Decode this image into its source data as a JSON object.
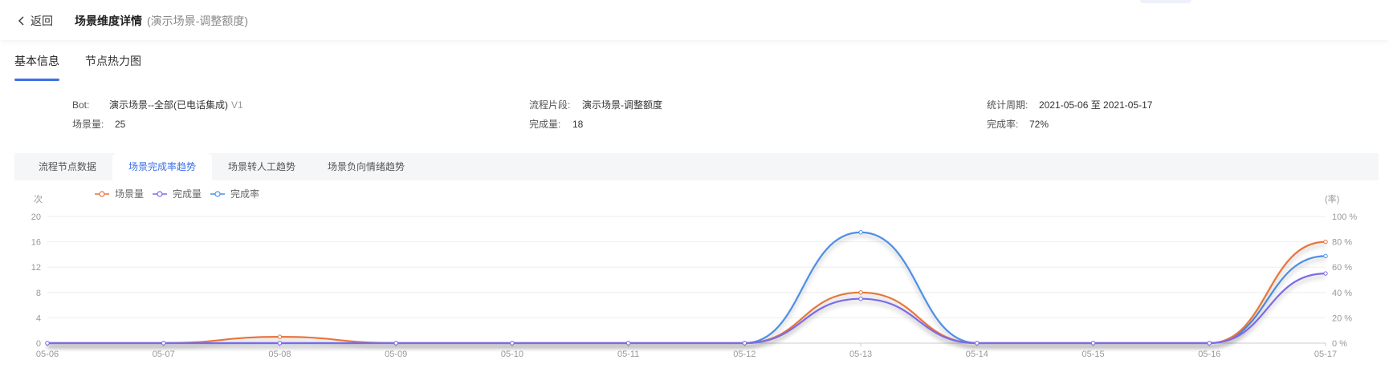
{
  "header": {
    "back_label": "返回",
    "title": "场景维度详情",
    "subtitle": "(演示场景-调整额度)"
  },
  "tabs": [
    {
      "label": "基本信息",
      "active": true
    },
    {
      "label": "节点热力图",
      "active": false
    }
  ],
  "info": {
    "bot_label": "Bot:",
    "bot_value": "演示场景--全部(已电话集成)",
    "bot_version": "V1",
    "flow_label": "流程片段:",
    "flow_value": "演示场景-调整额度",
    "period_label": "统计周期:",
    "period_value": "2021-05-06 至 2021-05-17",
    "scene_label": "场景量:",
    "scene_value": "25",
    "done_label": "完成量:",
    "done_value": "18",
    "rate_label": "完成率:",
    "rate_value": "72%"
  },
  "subtabs": [
    {
      "label": "流程节点数据",
      "active": false
    },
    {
      "label": "场景完成率趋势",
      "active": true
    },
    {
      "label": "场景转人工趋势",
      "active": false
    },
    {
      "label": "场景负向情绪趋势",
      "active": false
    }
  ],
  "colors": {
    "scene": "#e8743b",
    "done": "#7b6ae8",
    "rate": "#4e8fe8",
    "accent": "#3c6fe8"
  },
  "chart_data": {
    "type": "line",
    "left_axis_title": "次",
    "right_axis_title": "(率)",
    "x": [
      "05-06",
      "05-07",
      "05-08",
      "05-09",
      "05-10",
      "05-11",
      "05-12",
      "05-13",
      "05-14",
      "05-15",
      "05-16",
      "05-17"
    ],
    "ylim_left": [
      0,
      20
    ],
    "yticks_left": [
      "0",
      "4",
      "8",
      "12",
      "16",
      "20"
    ],
    "ylim_right": [
      0,
      100
    ],
    "yticks_right": [
      "0 %",
      "20 %",
      "40 %",
      "60 %",
      "80 %",
      "100 %"
    ],
    "series": [
      {
        "name": "场景量",
        "axis": "left",
        "color_key": "scene",
        "values": [
          0,
          0,
          1,
          0,
          0,
          0,
          0,
          8,
          0,
          0,
          0,
          16
        ]
      },
      {
        "name": "完成量",
        "axis": "left",
        "color_key": "done",
        "values": [
          0,
          0,
          0,
          0,
          0,
          0,
          0,
          7,
          0,
          0,
          0,
          11
        ]
      },
      {
        "name": "完成率",
        "axis": "right",
        "color_key": "rate",
        "values": [
          0,
          0,
          0,
          0,
          0,
          0,
          0,
          87.5,
          0,
          0,
          0,
          68.75
        ]
      }
    ],
    "legend_position": "top-left",
    "grid": true
  }
}
